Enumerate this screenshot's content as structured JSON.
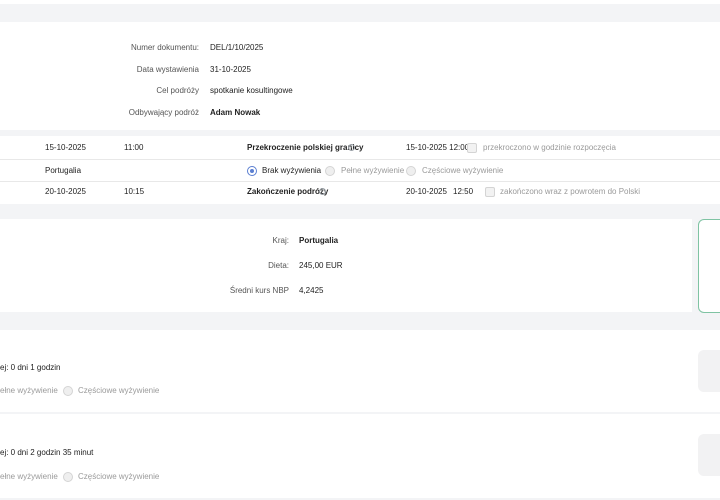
{
  "document": {
    "number_label": "Numer dokumentu:",
    "number_value": "DEL/1/10/2025",
    "date_label": "Data wystawienia",
    "date_value": "31-10-2025",
    "purpose_label": "Cel podróży",
    "purpose_value": "spotkanie kosultingowe",
    "traveler_label": "Odbywający podróż",
    "traveler_value": "Adam Nowak"
  },
  "trip": {
    "start_date": "15-10-2025",
    "start_time": "11:00",
    "border_label": "Przekroczenie polskiej granicy",
    "border_datetime": "15-10-2025 12:00",
    "border_checkbox_label": "przekroczono w godzinie rozpoczęcia",
    "country": "Portugalia",
    "meals": {
      "none": "Brak wyżywienia",
      "full": "Pełne wyżywienie",
      "partial": "Częściowe wyżywienie"
    },
    "end_date": "20-10-2025",
    "end_time": "10:15",
    "end_label": "Zakończenie podróży",
    "end_date2": "20-10-2025",
    "end_time2": "12:50",
    "end_checkbox_label": "zakończono wraz z powrotem do Polski",
    "info_icon": "i"
  },
  "allowance": {
    "country_label": "Kraj:",
    "country_value": "Portugalia",
    "diet_label": "Dieta:",
    "diet_value": "245,00 EUR",
    "rate_label": "Średni kurs NBP",
    "rate_value": "4,2425"
  },
  "segments": [
    {
      "duration": "ej: 0 dni 1 godzin",
      "full_meal": "ełne wyżywienie",
      "partial_meal": "Częściowe wyżywienie"
    },
    {
      "duration": "ej: 0 dni 2 godzin 35 minut",
      "full_meal": "ełne wyżywienie",
      "partial_meal": "Częściowe wyżywienie"
    }
  ],
  "colors": {
    "accent": "#5b7fd1",
    "sidebox_border": "#7fc3a3"
  }
}
